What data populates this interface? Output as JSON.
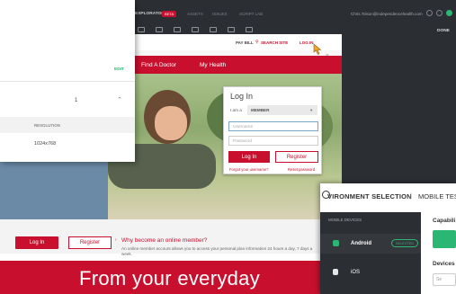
{
  "appbar": {
    "title": "EXPLORATORY",
    "badge": "BETA",
    "nav": [
      "ASSETS",
      "ISSUES",
      "SCRIPT LAB"
    ],
    "user": "Chris.Tolson@independencehealth.com",
    "done_label": "DONE"
  },
  "settings_panel": {
    "edit_label": "EDIT",
    "count": "1",
    "resolution_header": "RESOLUTION",
    "resolution_value": "1024x768"
  },
  "site": {
    "pay_bill": "PAY BILL",
    "search_site": "SEARCH SITE",
    "log_in_link": "LOG IN",
    "nav": [
      "Find A Doctor",
      "My Health"
    ],
    "promo_title": "Why become an online member?",
    "promo_text": "An online member account allows you to access your personal plan information 24 hours a day, 7 days a week.",
    "login_button": "Log In",
    "register_button": "Register",
    "banner_text": "From your everyday"
  },
  "login_box": {
    "title": "Log In",
    "i_am_label": "I am a",
    "member_select": "MEMBER",
    "username_placeholder": "Username",
    "password_placeholder": "Password",
    "login_button": "Log In",
    "register_button": "Register",
    "forgot_link": "Forgot your username?",
    "reset_link": "Reset password"
  },
  "env_panel": {
    "title": "VIRONMENT SELECTION",
    "separator": "|",
    "mobile_tab": "MOBILE TESTI",
    "mobile_devices_header": "MOBILE DEVICES",
    "android_label": "Android",
    "selected_badge": "SELECTED",
    "ios_label": "iOS",
    "capabilities_label": "Capabili",
    "devices_label": "Devices",
    "search_placeholder": "Se"
  },
  "colors": {
    "brand_red": "#c8102e",
    "accent_green": "#2bb673",
    "dark_bg": "#2b2e33"
  }
}
